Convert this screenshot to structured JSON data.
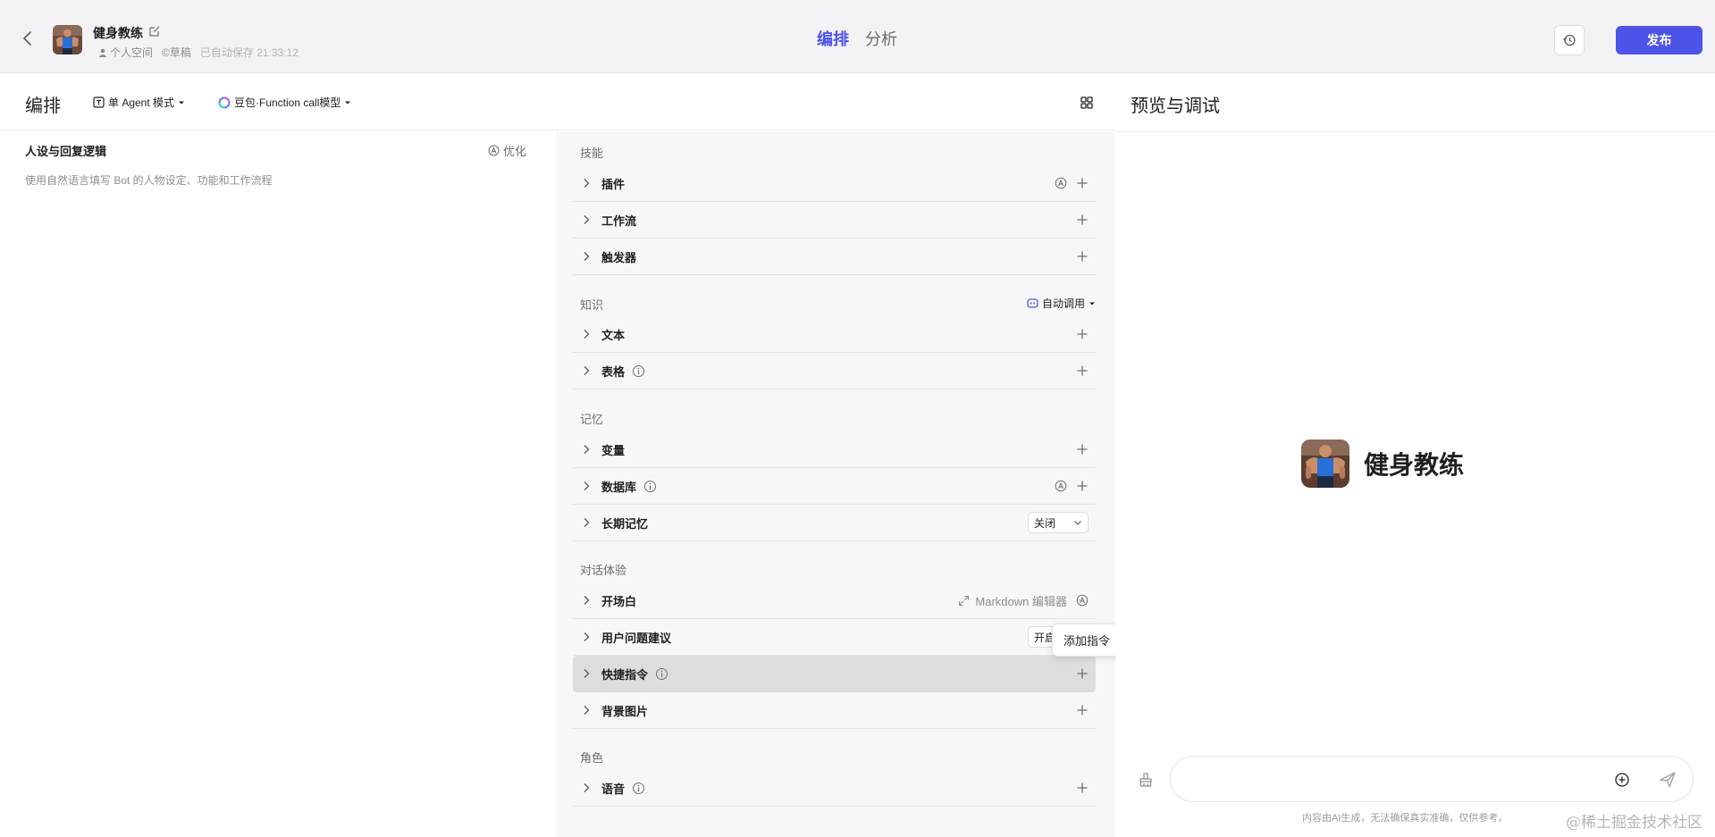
{
  "header": {
    "bot_name": "健身教练",
    "workspace": "个人空间",
    "draft": "©草稿",
    "autosave": "已自动保存 21:33:12",
    "tabs": [
      {
        "label": "编排",
        "active": true
      },
      {
        "label": "分析",
        "active": false
      }
    ],
    "publish_label": "发布",
    "accent_color": "#4d53e8"
  },
  "arrange": {
    "title": "编排",
    "mode": "单 Agent 模式",
    "model": "豆包·Function call模型"
  },
  "persona": {
    "title": "人设与回复逻辑",
    "optimize_label": "优化",
    "placeholder": "使用自然语言填写 Bot 的人物设定、功能和工作流程"
  },
  "skills": {
    "sections": [
      {
        "label": "技能",
        "rows": [
          {
            "label": "插件",
            "auto": true
          },
          {
            "label": "工作流"
          },
          {
            "label": "触发器"
          }
        ]
      },
      {
        "label": "知识",
        "auto_call": "自动调用",
        "rows": [
          {
            "label": "文本"
          },
          {
            "label": "表格",
            "info": true
          }
        ]
      },
      {
        "label": "记忆",
        "rows": [
          {
            "label": "变量"
          },
          {
            "label": "数据库",
            "info": true,
            "auto": true
          },
          {
            "label": "长期记忆",
            "select": "关闭"
          }
        ]
      },
      {
        "label": "对话体验",
        "rows": [
          {
            "label": "开场白",
            "editor": "Markdown 编辑器"
          },
          {
            "label": "用户问题建议",
            "select": "开启"
          },
          {
            "label": "快捷指令",
            "info": true,
            "hover": true
          },
          {
            "label": "背景图片"
          }
        ]
      },
      {
        "label": "角色",
        "rows": [
          {
            "label": "语音",
            "info": true
          }
        ]
      }
    ],
    "tooltip": "添加指令"
  },
  "preview": {
    "title": "预览与调试",
    "bot_name": "健身教练",
    "input_placeholder": "",
    "disclaimer": "内容由AI生成，无法确保真实准确，仅供参考。"
  },
  "watermark": "@稀土掘金技术社区"
}
